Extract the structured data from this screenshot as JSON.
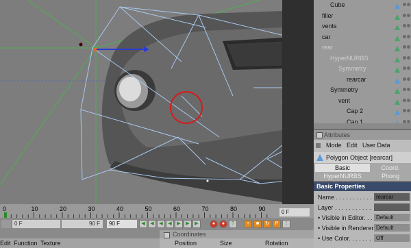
{
  "object_manager": {
    "items": [
      {
        "name": "Cube",
        "indent": 1,
        "icon": "cube-icon",
        "dim": false
      },
      {
        "name": "filler",
        "indent": 0,
        "icon": "null-icon",
        "dim": false
      },
      {
        "name": "vents",
        "indent": 0,
        "icon": "null-icon",
        "dim": false
      },
      {
        "name": "car",
        "indent": 0,
        "icon": "null-icon",
        "dim": false
      },
      {
        "name": "rear",
        "indent": 0,
        "icon": "null-icon",
        "dim": true
      },
      {
        "name": "HyperNURBS",
        "indent": 1,
        "icon": "hypernurbs-icon",
        "dim": true
      },
      {
        "name": "Symmetry",
        "indent": 2,
        "icon": "symmetry-icon",
        "dim": true
      },
      {
        "name": "rearcar",
        "indent": 3,
        "icon": "polygon-icon",
        "dim": false
      },
      {
        "name": "Symmetry",
        "indent": 1,
        "icon": "symmetry-icon",
        "dim": false
      },
      {
        "name": "vent",
        "indent": 2,
        "icon": "null-icon",
        "dim": false
      },
      {
        "name": "Cap 2",
        "indent": 3,
        "icon": "polygon-icon",
        "dim": false
      },
      {
        "name": "Cap 1",
        "indent": 3,
        "icon": "polygon-icon",
        "dim": false
      }
    ]
  },
  "attributes": {
    "title": "Attributes",
    "menu": [
      "Mode",
      "Edit",
      "User Data"
    ],
    "object_label": "Polygon Object [rearcar]",
    "tabs": [
      "Basic",
      "Coord.",
      "HyperNURBS Weight",
      "Phong"
    ],
    "section_title": "Basic Properties",
    "properties": [
      {
        "label": "Name . . . . . . . . . . .",
        "value": "rearcar",
        "field": "dark"
      },
      {
        "label": "Layer . . . . . . . . . . .",
        "value": "",
        "field": "dark"
      },
      {
        "label": "• Visible in Editor. . .",
        "value": "Default",
        "field": "gray"
      },
      {
        "label": "• Visible in Renderer .",
        "value": "Default",
        "field": "gray"
      },
      {
        "label": "• Use Color. . . . . . .",
        "value": "Off",
        "field": "gray"
      }
    ]
  },
  "timeline": {
    "ticks": [
      "0",
      "10",
      "20",
      "30",
      "40",
      "50",
      "60",
      "70",
      "80",
      "90"
    ],
    "current_frame": "0 F"
  },
  "playbar": {
    "start_frame": "0 F",
    "end_frame_display": "90 F",
    "end_frame": "90 F"
  },
  "material_menu": [
    "Edit",
    "Function",
    "Texture"
  ],
  "coordinates": {
    "title": "Coordinates",
    "columns": [
      "Position",
      "Size",
      "Rotation"
    ]
  },
  "colors": {
    "selection_circle": "#d41c1c",
    "cage_lines": "#a9c8ef",
    "green_guides": "#4fb04f",
    "axis_blue": "#2a3ad8"
  }
}
